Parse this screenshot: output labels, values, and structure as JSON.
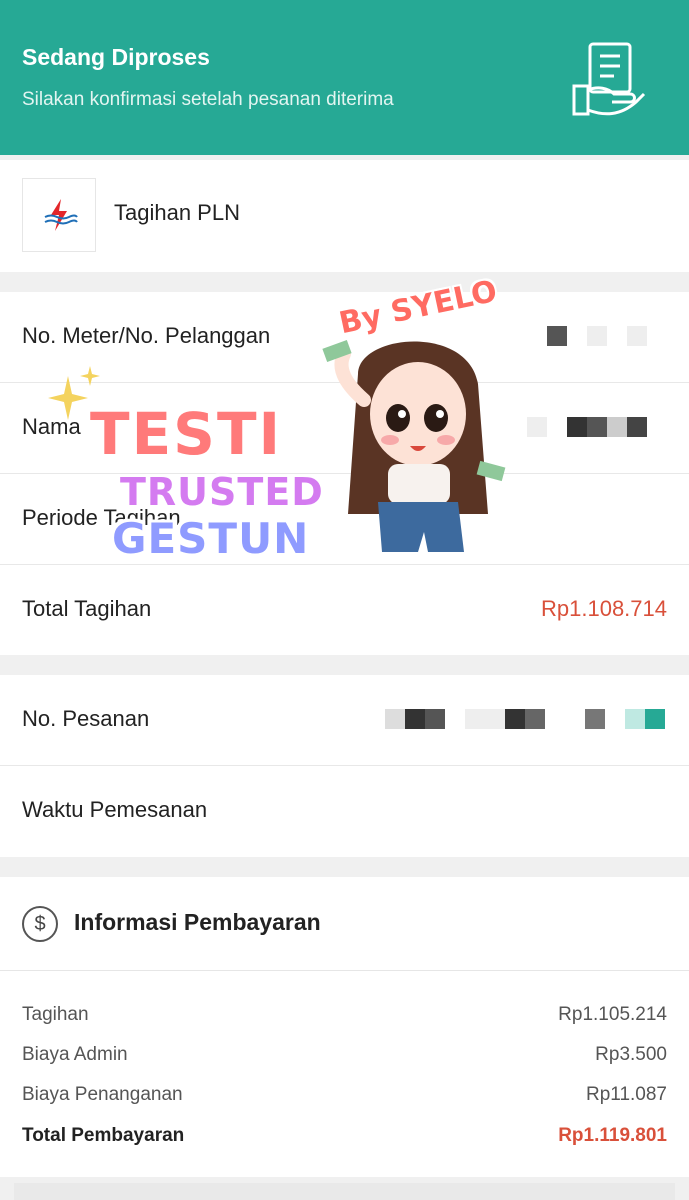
{
  "header": {
    "title": "Sedang Diproses",
    "subtitle": "Silakan konfirmasi setelah pesanan diterima",
    "icon": "receipt-hand-icon",
    "background_color": "#26a995"
  },
  "product": {
    "name": "Tagihan PLN",
    "logo": "pln-logo-icon"
  },
  "details": {
    "meter_label": "No. Meter/No. Pelanggan",
    "name_label": "Nama",
    "period_label": "Periode Tagihan",
    "total_label": "Total Tagihan",
    "total_value": "Rp1.108.714"
  },
  "order": {
    "order_no_label": "No. Pesanan",
    "order_time_label": "Waktu Pemesanan"
  },
  "payment": {
    "title": "Informasi Pembayaran",
    "icon": "dollar-circle-icon",
    "lines": [
      {
        "label": "Tagihan",
        "value": "Rp1.105.214"
      },
      {
        "label": "Biaya Admin",
        "value": "Rp3.500"
      },
      {
        "label": "Biaya Penanganan",
        "value": "Rp11.087"
      }
    ],
    "total_label": "Total Pembayaran",
    "total_value": "Rp1.119.801",
    "accent_color": "#d9503a"
  },
  "sticker": {
    "by": "By SYELO",
    "word1": "TESTI",
    "word2": "TRUSTED",
    "word3": "GESTUN"
  }
}
